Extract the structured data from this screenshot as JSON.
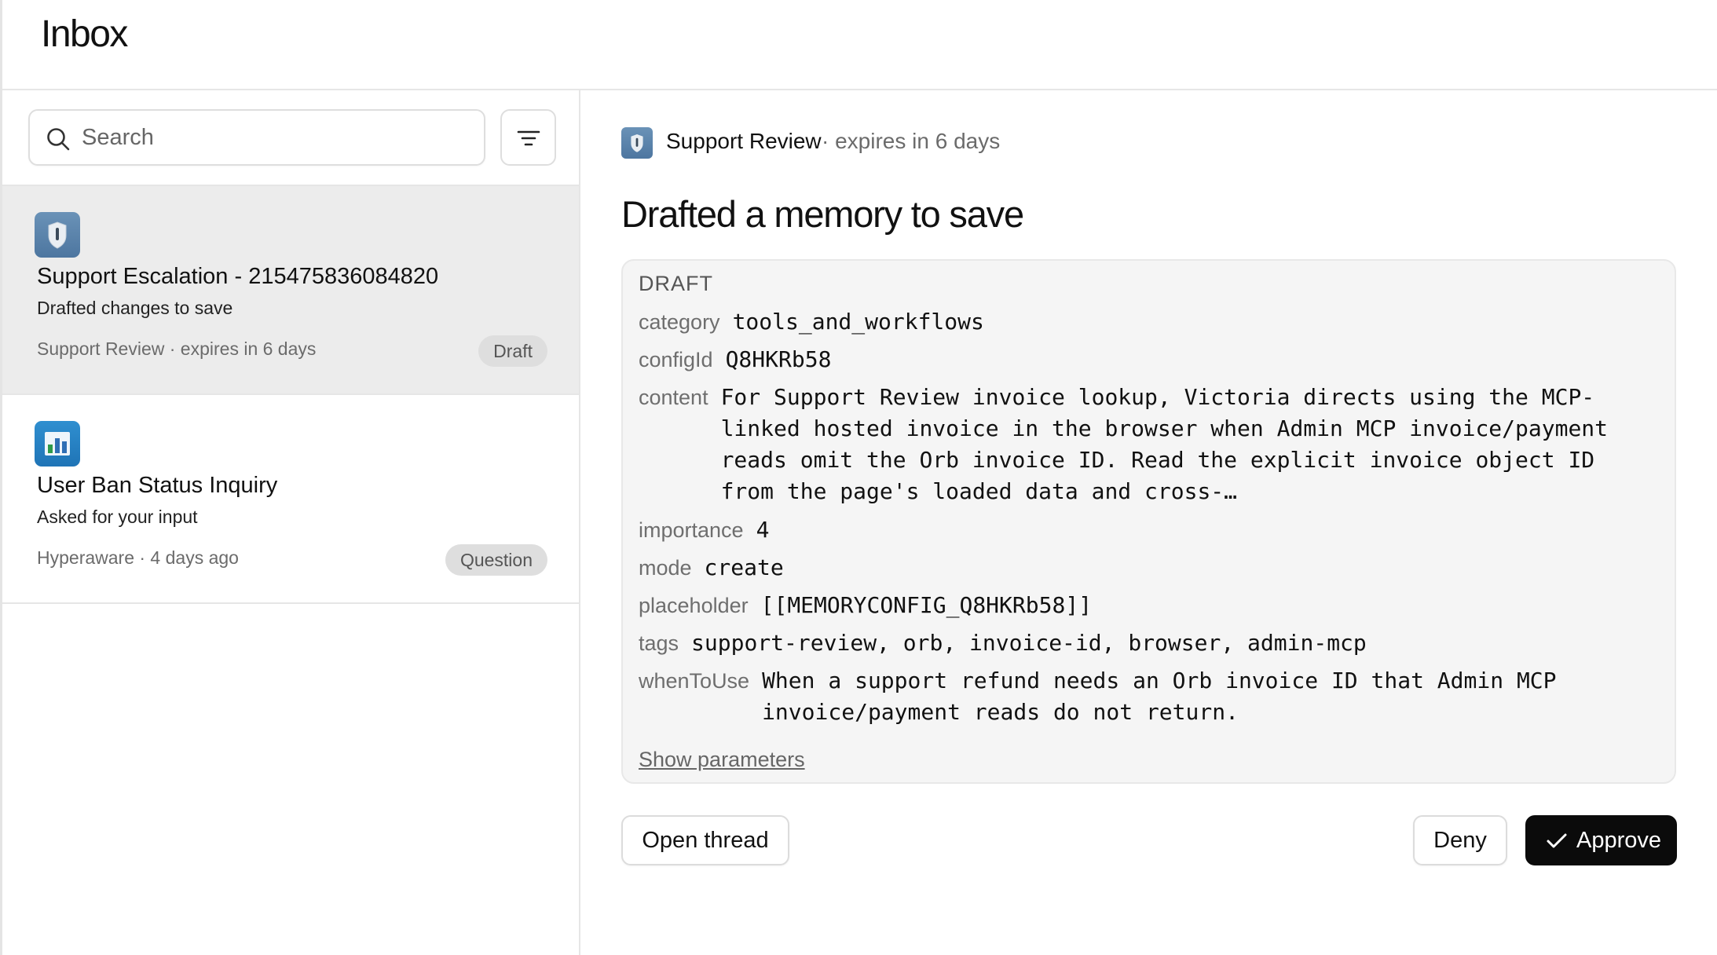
{
  "header": {
    "title": "Inbox"
  },
  "search": {
    "placeholder": "Search"
  },
  "inbox_items": [
    {
      "icon": "shield-app-icon",
      "title": "Support Escalation - 215475836084820",
      "subtitle": "Drafted changes to save",
      "meta": "Support Review · expires in 6 days",
      "badge": "Draft",
      "selected": true
    },
    {
      "icon": "bar-chart-app-icon",
      "title": "User Ban Status Inquiry",
      "subtitle": "Asked for your input",
      "meta": "Hyperaware · 4 days ago",
      "badge": "Question",
      "selected": false
    }
  ],
  "detail": {
    "source_name": "Support Review",
    "source_meta": "· expires in 6 days",
    "heading": "Drafted a memory to save",
    "draft_label": "DRAFT",
    "fields": [
      {
        "key": "category",
        "value": "tools_and_workflows"
      },
      {
        "key": "configId",
        "value": "Q8HKRb58"
      },
      {
        "key": "content",
        "value": "For Support Review invoice lookup, Victoria directs using the MCP-linked hosted invoice in the browser when Admin MCP invoice/payment reads omit the Orb invoice ID. Read the explicit invoice object ID from the page's loaded data and cross-…"
      },
      {
        "key": "importance",
        "value": "4"
      },
      {
        "key": "mode",
        "value": "create"
      },
      {
        "key": "placeholder",
        "value": "[[MEMORYCONFIG_Q8HKRb58]]"
      },
      {
        "key": "tags",
        "value": "support-review, orb, invoice-id, browser, admin-mcp"
      },
      {
        "key": "whenToUse",
        "value": "When a support refund needs an Orb invoice ID that Admin MCP invoice/payment reads do not return."
      }
    ],
    "show_parameters": "Show parameters"
  },
  "actions": {
    "open_thread": "Open thread",
    "deny": "Deny",
    "approve": "Approve"
  },
  "colors": {
    "selected_row": "#ececec",
    "approve_bg": "#0b0b0b",
    "badge_bg": "#dedede",
    "draft_card_bg": "#f5f5f5"
  }
}
